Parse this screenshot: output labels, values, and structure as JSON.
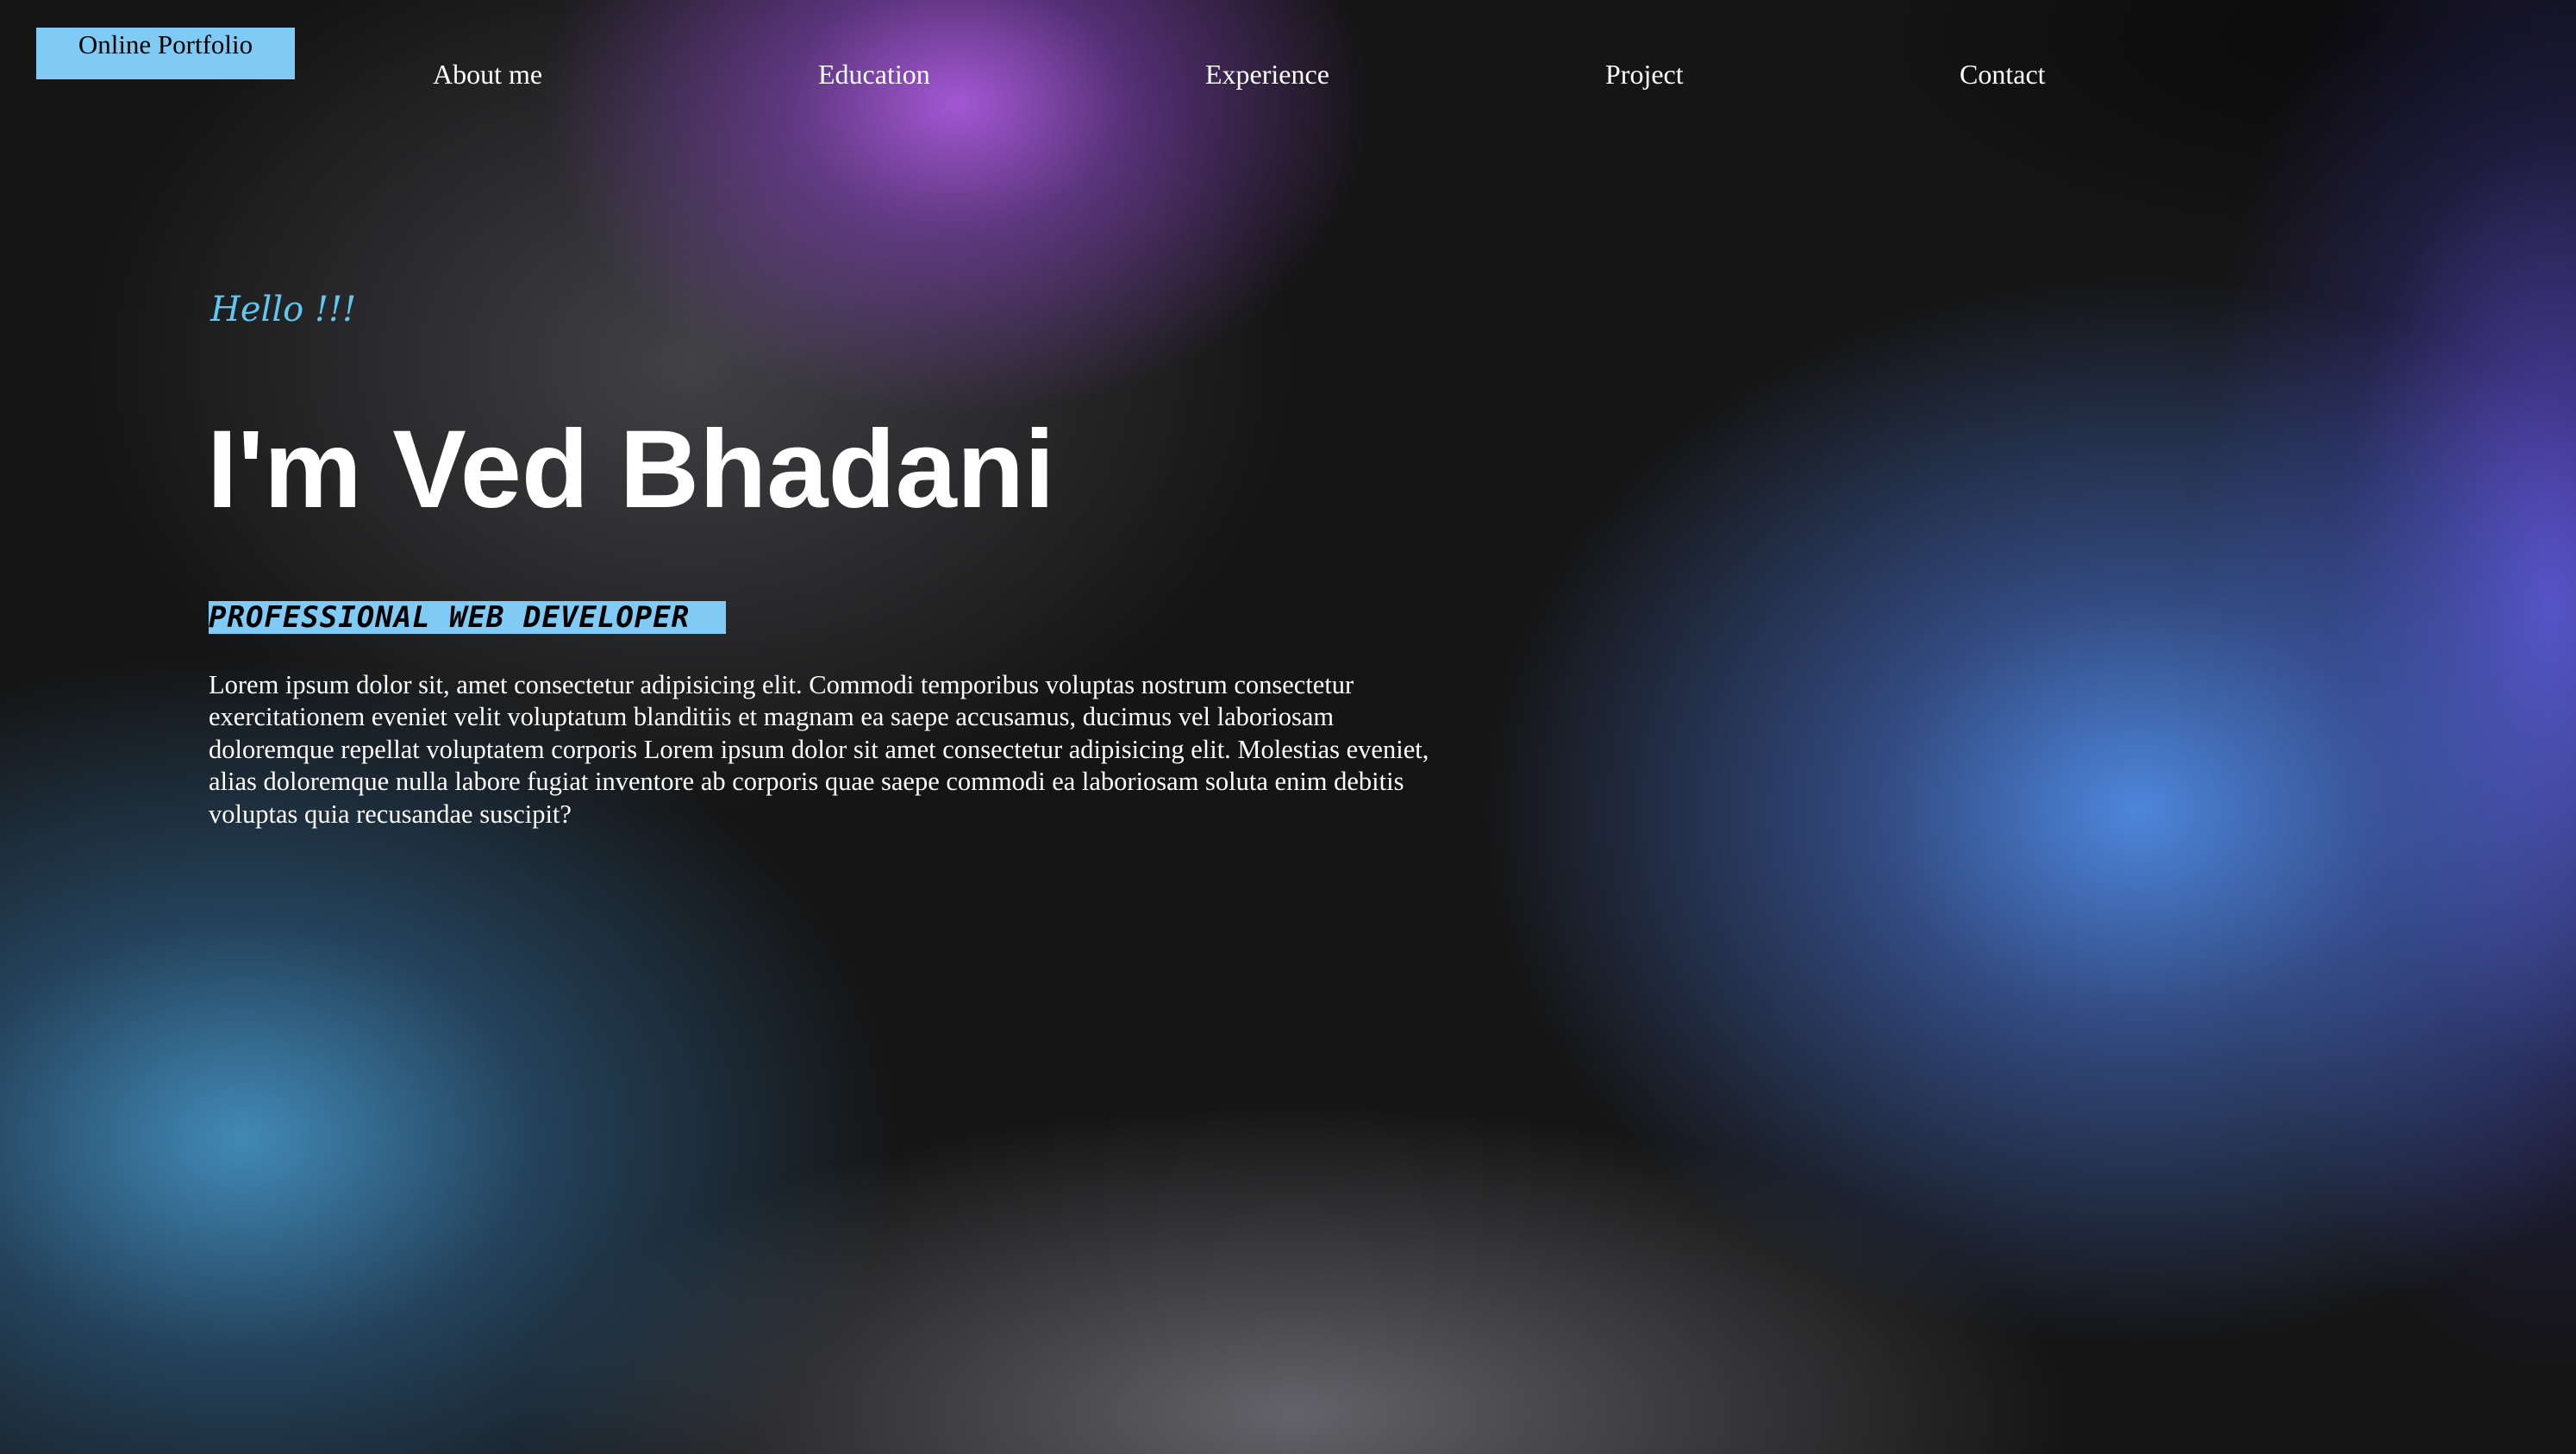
{
  "header": {
    "brand": "Online Portfolio",
    "nav": [
      {
        "label": "About me"
      },
      {
        "label": "Education"
      },
      {
        "label": "Experience"
      },
      {
        "label": "Project"
      },
      {
        "label": "Contact"
      }
    ]
  },
  "hero": {
    "greeting": "Hello !!!",
    "name": "I'm Ved Bhadani",
    "role": "PROFESSIONAL WEB DEVELOPER",
    "description": "Lorem ipsum dolor sit, amet consectetur adipisicing elit. Commodi temporibus voluptas nostrum consectetur exercitationem eveniet velit voluptatum blanditiis et magnam ea saepe accusamus, ducimus vel laboriosam doloremque repellat voluptatem corporis Lorem ipsum dolor sit amet consectetur adipisicing elit. Molestias eveniet, alias doloremque nulla labore fugiat inventore ab corporis quae saepe commodi ea laboriosam soluta enim debitis voluptas quia recusandae suscipit?"
  },
  "colors": {
    "accent": "#7fcbf5",
    "greeting": "#5ec8f2",
    "text": "#ffffff",
    "background": "#151515"
  }
}
